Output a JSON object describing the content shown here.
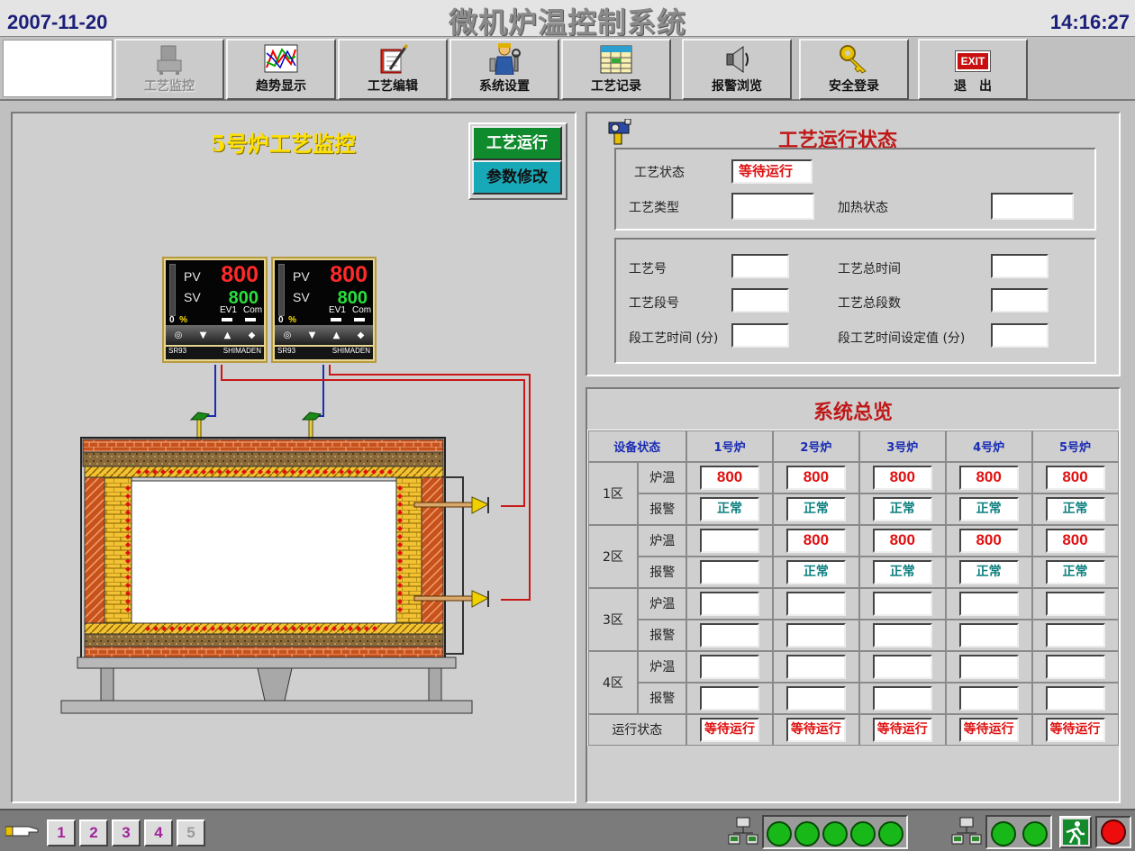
{
  "header": {
    "date": "2007-11-20",
    "title": "微机炉温控制系统",
    "time": "14:16:27"
  },
  "toolbar": {
    "buttons": [
      {
        "label": "工艺监控",
        "icon": "furnace-monitor-icon",
        "enabled": false
      },
      {
        "label": "趋势显示",
        "icon": "trend-chart-icon",
        "enabled": true
      },
      {
        "label": "工艺编辑",
        "icon": "edit-notebook-icon",
        "enabled": true
      },
      {
        "label": "系统设置",
        "icon": "settings-worker-icon",
        "enabled": true
      },
      {
        "label": "工艺记录",
        "icon": "record-table-icon",
        "enabled": true
      },
      {
        "label": "报警浏览",
        "icon": "speaker-alarm-icon",
        "enabled": true
      },
      {
        "label": "安全登录",
        "icon": "key-icon",
        "enabled": true
      },
      {
        "label": "退　出",
        "icon": "exit-icon",
        "icon_text": "EXIT",
        "enabled": true
      }
    ]
  },
  "monitor": {
    "title": "5号炉工艺监控",
    "run_button": "工艺运行",
    "param_button": "参数修改",
    "controllers": [
      {
        "pv_label": "PV",
        "pv": "800",
        "sv_label": "SV",
        "sv": "800",
        "ev_label": "EV1",
        "com_label": "Com",
        "zero": "0",
        "pct": "%",
        "model": "SR93",
        "brand": "SHIMADEN"
      },
      {
        "pv_label": "PV",
        "pv": "800",
        "sv_label": "SV",
        "sv": "800",
        "ev_label": "EV1",
        "com_label": "Com",
        "zero": "0",
        "pct": "%",
        "model": "SR93",
        "brand": "SHIMADEN"
      }
    ]
  },
  "status": {
    "title": "工艺运行状态",
    "process_state_label": "工艺状态",
    "process_state_value": "等待运行",
    "process_type_label": "工艺类型",
    "process_type_value": "",
    "heating_state_label": "加热状态",
    "heating_state_value": "",
    "process_no_label": "工艺号",
    "process_no_value": "",
    "total_time_label": "工艺总时间",
    "total_time_value": "",
    "segment_no_label": "工艺段号",
    "segment_no_value": "",
    "total_segments_label": "工艺总段数",
    "total_segments_value": "",
    "segment_time_label": "段工艺时间 (分)",
    "segment_time_value": "",
    "segment_setpoint_label": "段工艺时间设定值 (分)",
    "segment_setpoint_value": ""
  },
  "overview": {
    "title": "系统总览",
    "header_label": "设备状态",
    "furnaces": [
      "1号炉",
      "2号炉",
      "3号炉",
      "4号炉",
      "5号炉"
    ],
    "temp_label": "炉温",
    "alarm_labels": [
      "报警",
      "报警",
      "报警",
      "报警"
    ],
    "run_state_label": "运行状态",
    "zones": [
      {
        "name": "1区",
        "temps": [
          "800",
          "800",
          "800",
          "800",
          "800"
        ],
        "alarms": [
          "正常",
          "正常",
          "正常",
          "正常",
          "正常"
        ]
      },
      {
        "name": "2区",
        "temps": [
          "",
          "800",
          "800",
          "800",
          "800"
        ],
        "alarms": [
          "",
          "正常",
          "正常",
          "正常",
          "正常"
        ]
      },
      {
        "name": "3区",
        "temps": [
          "",
          "",
          "",
          "",
          ""
        ],
        "alarms": [
          "",
          "",
          "",
          "",
          ""
        ]
      },
      {
        "name": "4区",
        "temps": [
          "",
          "",
          "",
          "",
          ""
        ],
        "alarms": [
          "",
          "",
          "",
          "",
          ""
        ]
      }
    ],
    "run_states": [
      "等待运行",
      "等待运行",
      "等待运行",
      "等待运行",
      "等待运行"
    ]
  },
  "bottom": {
    "pages": [
      "1",
      "2",
      "3",
      "4",
      "5"
    ],
    "comm_lamps_group1": [
      "green",
      "green",
      "green",
      "green",
      "green"
    ],
    "comm_lamps_group2": [
      "green",
      "green"
    ],
    "alarm_lamp": "red"
  },
  "colors": {
    "accent_red": "#c01818",
    "ok_teal": "#0e8080",
    "run_green": "#0f8a2c",
    "param_cyan": "#18a9b9",
    "title_yellow": "#ffe000"
  }
}
